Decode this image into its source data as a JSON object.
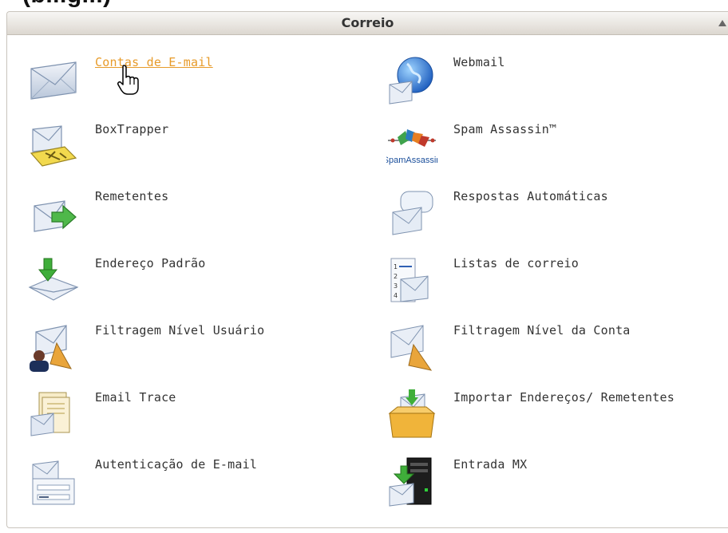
{
  "page_top_fragment": "(b...g...)",
  "panel": {
    "title": "Correio",
    "collapse_icon": "triangle-up-icon"
  },
  "colors": {
    "link_hover": "#e79b2a",
    "label": "#333333",
    "header_border": "#c4beb5"
  },
  "items": [
    {
      "label": "Contas de E-mail",
      "icon": "envelope-icon",
      "state": "hovered"
    },
    {
      "label": "Webmail",
      "icon": "globe-envelope-icon"
    },
    {
      "label": "BoxTrapper",
      "icon": "envelope-trap-icon"
    },
    {
      "label": "Spam Assassin™",
      "icon": "spamassassin-logo-icon",
      "icon_text": "SpamAssassin"
    },
    {
      "label": "Remetentes",
      "icon": "envelope-forward-arrow-icon"
    },
    {
      "label": "Respostas Automáticas",
      "icon": "speech-bubble-envelope-icon"
    },
    {
      "label": "Endereço Padrão",
      "icon": "down-arrow-envelope-icon"
    },
    {
      "label": "Listas de correio",
      "icon": "numbered-list-envelope-icon"
    },
    {
      "label": "Filtragem Nível Usuário",
      "icon": "user-filter-envelope-icon"
    },
    {
      "label": "Filtragem Nível da Conta",
      "icon": "funnel-envelope-icon"
    },
    {
      "label": "Email Trace",
      "icon": "document-envelope-icon"
    },
    {
      "label": "Importar Endereços/ Remetentes",
      "icon": "import-box-icon"
    },
    {
      "label": "Autenticação de E-mail",
      "icon": "authentication-envelope-icon"
    },
    {
      "label": "Entrada MX",
      "icon": "server-envelope-icon"
    }
  ]
}
